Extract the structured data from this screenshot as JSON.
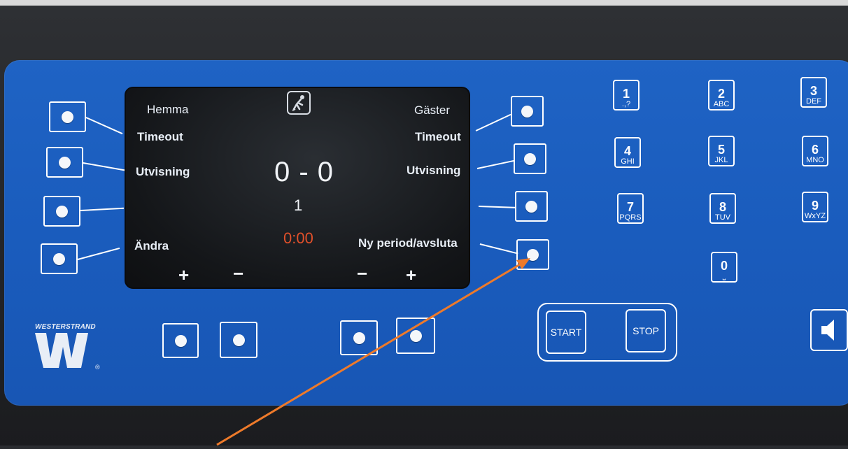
{
  "display": {
    "home_label": "Hemma",
    "away_label": "Gäster",
    "home_timeout": "Timeout",
    "away_timeout": "Timeout",
    "home_penalty": "Utvisning",
    "away_penalty": "Utvisning",
    "edit_label": "Ändra",
    "new_period_label": "Ny period/avsluta",
    "score": "0 - 0",
    "period": "1",
    "clock": "0:00",
    "plus_left": "+",
    "minus_left": "−",
    "minus_right": "−",
    "plus_right": "+",
    "sport_icon": "hockey-player-icon"
  },
  "keypad": [
    {
      "num": "1",
      "sub": ".,?"
    },
    {
      "num": "2",
      "sub": "ABC"
    },
    {
      "num": "3",
      "sub": "DEF"
    },
    {
      "num": "4",
      "sub": "GHI"
    },
    {
      "num": "5",
      "sub": "JKL"
    },
    {
      "num": "6",
      "sub": "MNO"
    },
    {
      "num": "7",
      "sub": "PQRS"
    },
    {
      "num": "8",
      "sub": "TUV"
    },
    {
      "num": "9",
      "sub": "WxYZ"
    },
    {
      "num": "0",
      "sub": "⎵"
    }
  ],
  "controls": {
    "start_label": "START",
    "stop_label": "STOP",
    "speaker_icon": "speaker-icon"
  },
  "brand": {
    "name": "WESTERSTRAND",
    "trademark": "®"
  },
  "colors": {
    "panel_blue": "#1a5cbd",
    "clock_red": "#e0502a",
    "annotation_arrow": "#ee7a2a"
  }
}
